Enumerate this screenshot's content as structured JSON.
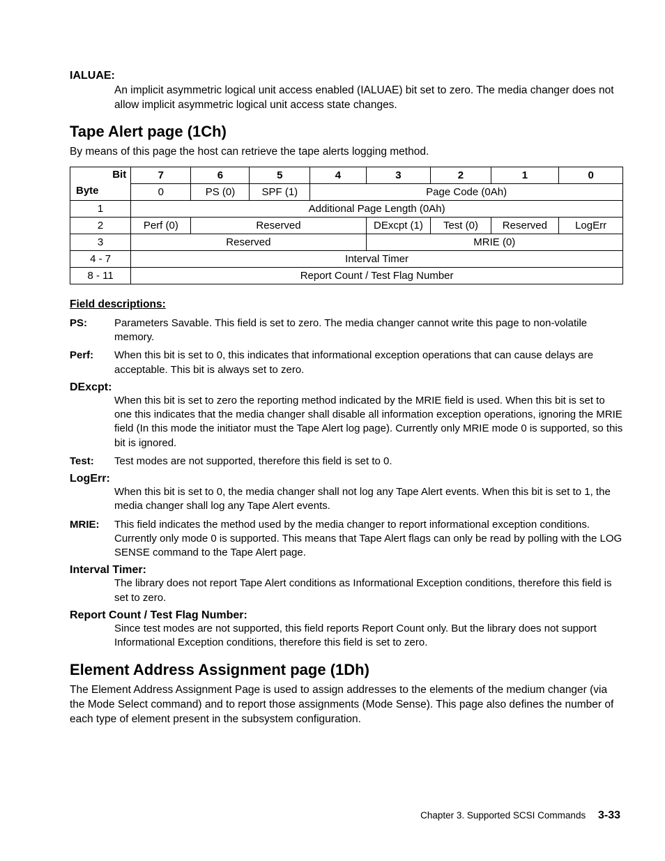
{
  "ialuae": {
    "term": "IALUAE:",
    "def": "An implicit asymmetric logical unit access enabled (IALUAE) bit set to zero. The media changer does not allow implicit asymmetric logical unit access state changes."
  },
  "section1": {
    "title": "Tape Alert page (1Ch)",
    "intro": "By means of this page the host can retrieve the tape alerts logging method."
  },
  "table": {
    "hdr": {
      "bit": "Bit",
      "byte": "Byte",
      "c7": "7",
      "c6": "6",
      "c5": "5",
      "c4": "4",
      "c3": "3",
      "c2": "2",
      "c1": "1",
      "c0": "0"
    },
    "r0": {
      "b": "0",
      "c7": "PS (0)",
      "c6": "SPF (1)",
      "page": "Page Code (0Ah)"
    },
    "r1": {
      "b": "1",
      "all": "Additional Page Length (0Ah)"
    },
    "r2": {
      "b": "2",
      "c7": "Perf (0)",
      "res1": "Reserved",
      "dex": "DExcpt (1)",
      "test": "Test (0)",
      "res2": "Reserved",
      "logerr": "LogErr"
    },
    "r3": {
      "b": "3",
      "res": "Reserved",
      "mrie": "MRIE (0)"
    },
    "r4": {
      "b": "4 - 7",
      "all": "Interval Timer"
    },
    "r5": {
      "b": "8 - 11",
      "all": "Report Count / Test Flag Number"
    }
  },
  "fields_header": "Field descriptions:",
  "fields": {
    "ps": {
      "t": "PS:",
      "d": "Parameters Savable. This field is set to zero. The media changer cannot write this page to non-volatile memory."
    },
    "perf": {
      "t": "Perf:",
      "d": "When this bit is set to 0, this indicates that informational exception operations that can cause delays are acceptable. This bit is always set to zero."
    },
    "dexcpt": {
      "t": "DExcpt:",
      "d": "When this bit is set to zero the reporting method indicated by the MRIE field is used. When this bit is set to one this indicates that the media changer shall disable all information exception operations, ignoring the MRIE field (In this mode the initiator must the Tape Alert log page). Currently only MRIE mode 0 is supported, so this bit is ignored."
    },
    "test": {
      "t": "Test:",
      "d": "Test modes are not supported, therefore this field is set to 0."
    },
    "logerr": {
      "t": "LogErr:",
      "d": "When this bit is set to 0, the media changer shall not log any Tape Alert events. When this bit is set to 1, the media changer shall log any Tape Alert events."
    },
    "mrie": {
      "t": "MRIE:",
      "d": "This field indicates the method used by the media changer to report informational exception conditions. Currently only mode 0 is supported. This means that Tape Alert flags can only be read by polling with the LOG SENSE command to the Tape Alert page."
    },
    "itimer": {
      "t": "Interval Timer:",
      "d": "The library does not report Tape Alert conditions as Informational Exception conditions, therefore this field is set to zero."
    },
    "rcount": {
      "t": "Report Count / Test Flag Number:",
      "d": "Since test modes are not supported, this field reports Report Count only. But the library does not support Informational Exception conditions, therefore this field is set to zero."
    }
  },
  "section2": {
    "title": "Element Address Assignment page (1Dh)",
    "intro": "The Element Address Assignment Page is used to assign addresses to the elements of the medium changer (via the Mode Select command) and to report those assignments (Mode Sense). This page also defines the number of each type of element present in the subsystem configuration."
  },
  "footer": {
    "chapter": "Chapter 3. Supported SCSI Commands",
    "page": "3-33"
  }
}
